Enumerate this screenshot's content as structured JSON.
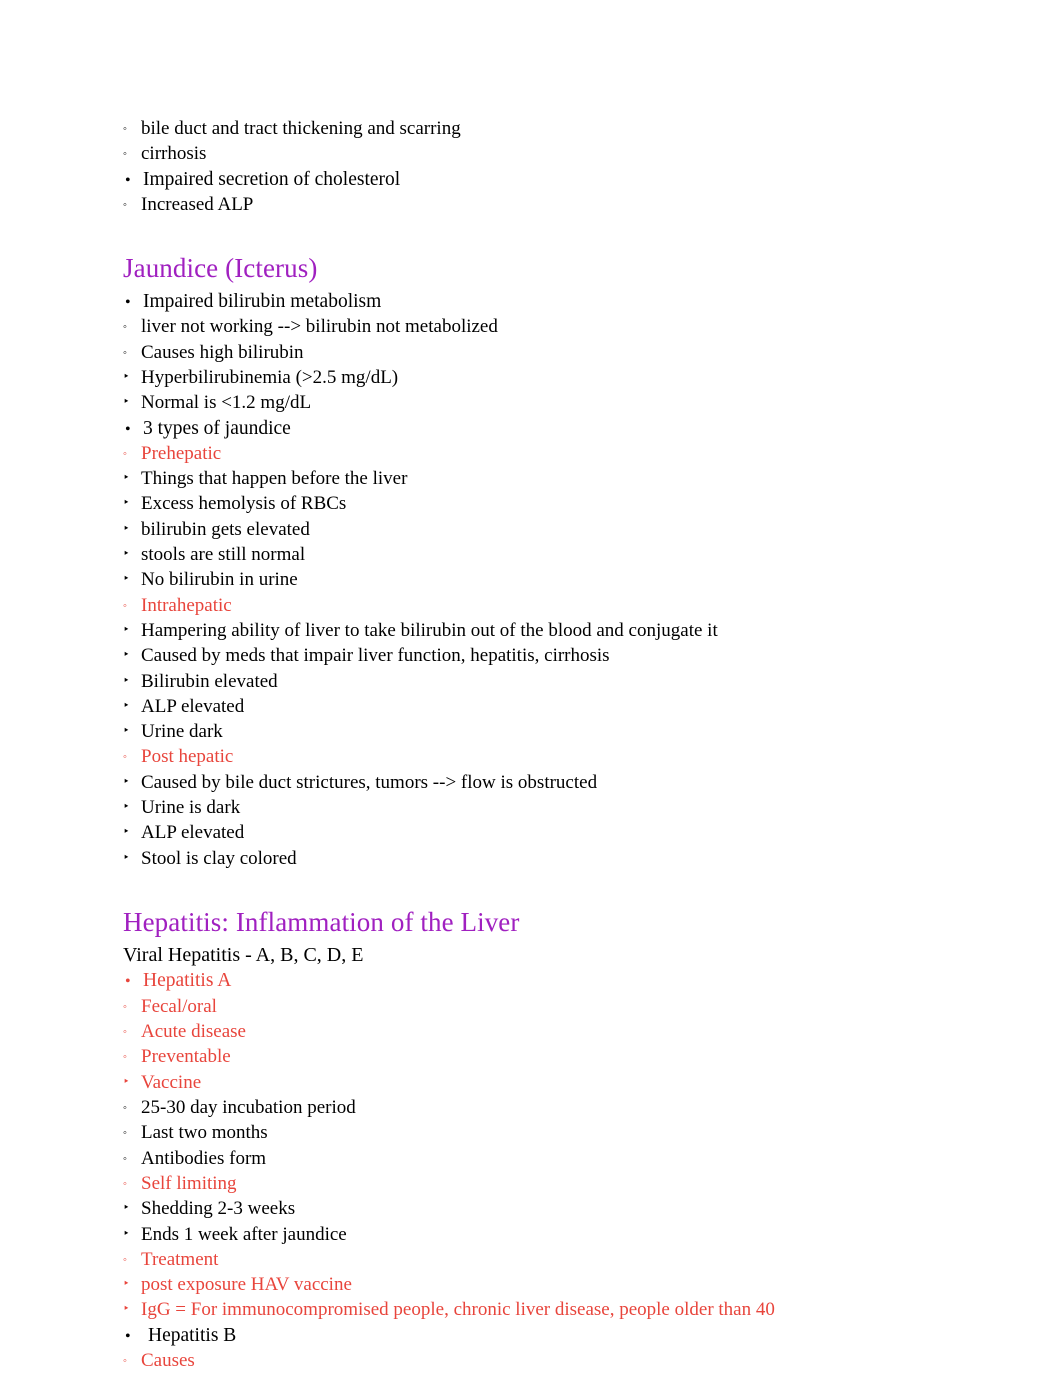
{
  "document": {
    "title": "Liver Pathophysiology Notes",
    "colors": {
      "heading_purple": "#A020C0",
      "accent_red": "#E8453C",
      "body_black": "#000000",
      "background": "#FFFFFF"
    },
    "bullets": {
      "level1": "•",
      "level2": "◦",
      "level3": "‣"
    }
  },
  "top_section": {
    "items": [
      {
        "text": "bile duct and tract thickening and scarring",
        "level": 2,
        "color": "black"
      },
      {
        "text": "cirrhosis",
        "level": 2,
        "color": "black"
      },
      {
        "text": "Impaired secretion of cholesterol",
        "level": 1,
        "color": "black"
      },
      {
        "text": "Increased ALP",
        "level": 2,
        "color": "black"
      }
    ]
  },
  "jaundice": {
    "heading": "Jaundice (Icterus)",
    "items": [
      {
        "text": "Impaired bilirubin metabolism",
        "level": 1,
        "color": "black"
      },
      {
        "text": "liver not working --> bilirubin not metabolized",
        "level": 2,
        "color": "black"
      },
      {
        "text": "Causes high bilirubin",
        "level": 2,
        "color": "black"
      },
      {
        "text": "Hyperbilirubinemia (>2.5 mg/dL)",
        "level": 3,
        "color": "black"
      },
      {
        "text": "Normal is <1.2 mg/dL",
        "level": 3,
        "color": "black"
      },
      {
        "text": "3 types of jaundice",
        "level": 1,
        "color": "black"
      },
      {
        "text": "Prehepatic",
        "level": 2,
        "color": "red"
      },
      {
        "text": "Things that happen before the liver",
        "level": 3,
        "color": "black"
      },
      {
        "text": "Excess hemolysis of RBCs",
        "level": 3,
        "color": "black"
      },
      {
        "text": "bilirubin gets elevated",
        "level": 3,
        "color": "black"
      },
      {
        "text": "stools are still normal",
        "level": 3,
        "color": "black"
      },
      {
        "text": "No bilirubin in urine",
        "level": 3,
        "color": "black"
      },
      {
        "text": "Intrahepatic",
        "level": 2,
        "color": "red"
      },
      {
        "text": "Hampering ability of liver to take bilirubin out of the blood and conjugate it",
        "level": 3,
        "color": "black"
      },
      {
        "text": "Caused by meds that impair liver function, hepatitis, cirrhosis",
        "level": 3,
        "color": "black"
      },
      {
        "text": "Bilirubin elevated",
        "level": 3,
        "color": "black"
      },
      {
        "text": "ALP elevated",
        "level": 3,
        "color": "black"
      },
      {
        "text": "Urine dark",
        "level": 3,
        "color": "black"
      },
      {
        "text": "Post hepatic",
        "level": 2,
        "color": "red"
      },
      {
        "text": "Caused by bile duct strictures, tumors --> flow is obstructed",
        "level": 3,
        "color": "black"
      },
      {
        "text": "Urine is dark",
        "level": 3,
        "color": "black"
      },
      {
        "text": "ALP elevated",
        "level": 3,
        "color": "black"
      },
      {
        "text": "Stool is clay colored",
        "level": 3,
        "color": "black"
      }
    ]
  },
  "hepatitis": {
    "heading": "Hepatitis: Inflammation of the Liver",
    "subtitle": "Viral Hepatitis - A, B, C, D, E",
    "items": [
      {
        "text": "Hepatitis A",
        "level": 1,
        "color": "red",
        "topic": true
      },
      {
        "text": "Fecal/oral",
        "level": 2,
        "color": "red"
      },
      {
        "text": "Acute disease",
        "level": 2,
        "color": "red"
      },
      {
        "text": "Preventable",
        "level": 2,
        "color": "red"
      },
      {
        "text": "Vaccine",
        "level": 3,
        "color": "red"
      },
      {
        "text": "25-30 day incubation period",
        "level": 2,
        "color": "black"
      },
      {
        "text": "Last two months",
        "level": 2,
        "color": "black"
      },
      {
        "text": "Antibodies form",
        "level": 2,
        "color": "black"
      },
      {
        "text": "Self limiting",
        "level": 2,
        "color": "red"
      },
      {
        "text": "Shedding 2-3 weeks",
        "level": 3,
        "color": "black"
      },
      {
        "text": "Ends 1 week after jaundice",
        "level": 3,
        "color": "black"
      },
      {
        "text": "Treatment",
        "level": 2,
        "color": "red"
      },
      {
        "text": "post exposure HAV vaccine",
        "level": 3,
        "color": "red"
      },
      {
        "text": "IgG = For immunocompromised people, chronic liver disease, people older than 40",
        "level": 3,
        "color": "red"
      },
      {
        "text": "Hepatitis B",
        "level": 1,
        "color": "black",
        "topic": true,
        "spaced": true
      },
      {
        "text": "Causes",
        "level": 2,
        "color": "red"
      }
    ]
  }
}
